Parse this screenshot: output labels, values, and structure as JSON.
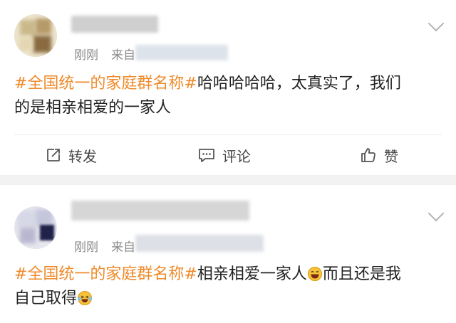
{
  "posts": [
    {
      "time": "刚刚",
      "source_prefix": "来自",
      "content": {
        "hashtag": "#全国统一的家庭群名称#",
        "text_line1": "哈哈哈哈哈，太真实了，我们",
        "text_line2": "的是相亲相爱的一家人"
      },
      "actions": {
        "repost": "转发",
        "comment": "评论",
        "like": "赞"
      }
    },
    {
      "time": "刚刚",
      "source_prefix": "来自",
      "content": {
        "hashtag": "#全国统一的家庭群名称#",
        "text_a": "相亲相爱一家人",
        "text_b": "而且还是我",
        "text_line2": "自己取得"
      }
    }
  ],
  "colors": {
    "hashtag": "#ef8a2a",
    "background": "#f2f2f2",
    "card": "#ffffff"
  },
  "icons": [
    "repost-icon",
    "comment-icon",
    "like-icon",
    "chevron-down-icon",
    "laughing-emoji",
    "laughing-tears-emoji"
  ]
}
